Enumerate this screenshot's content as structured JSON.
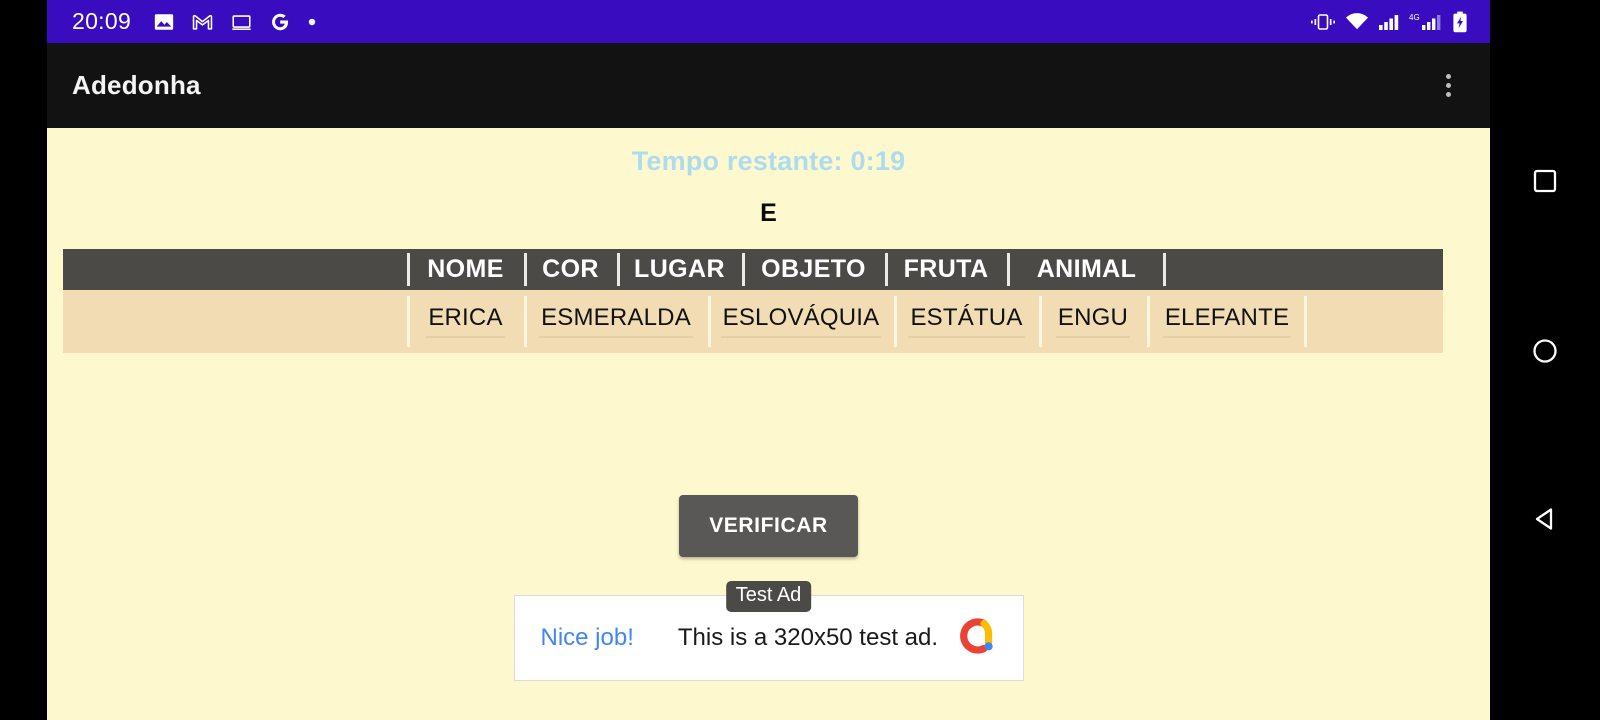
{
  "status_bar": {
    "clock": "20:09",
    "left_icons": [
      "photos-icon",
      "gmail-icon",
      "desktop-icon",
      "google-icon",
      "dot-icon"
    ],
    "right_icons": [
      "vibrate-icon",
      "wifi-icon",
      "signal-icon",
      "mobile-network-4g-icon",
      "battery-charging-icon"
    ],
    "network_type": "4G",
    "background_color": "#3A0CC0"
  },
  "app_bar": {
    "title": "Adedonha",
    "overflow_menu": "more-options",
    "background_color": "#121212"
  },
  "game": {
    "timer_label": "Tempo restante: 0:19",
    "timer_color": "#AEDCEE",
    "letter": "E",
    "page_background": "#FDF8CE",
    "header_background": "#4C4A46",
    "row_background": "#F2DCB3",
    "columns": [
      "NOME",
      "COR",
      "LUGAR",
      "OBJETO",
      "FRUTA",
      "ANIMAL"
    ],
    "answers": {
      "nome": "ERICA",
      "cor": "ESMERALDA",
      "lugar": "ESLOVÁQUIA",
      "objeto": "ESTÁTUA",
      "fruta": "ENGU",
      "animal": "ELEFANTE"
    },
    "verify_button": "VERIFICAR",
    "verify_button_color": "#5A5856"
  },
  "ad": {
    "badge": "Test Ad",
    "cta": "Nice job!",
    "text": "This is a 320x50 test ad.",
    "cta_color": "#4285F4",
    "logo": "admob-logo"
  },
  "nav_bar": {
    "recents": "recents-square-button",
    "home": "home-circle-button",
    "back": "back-triangle-button"
  }
}
